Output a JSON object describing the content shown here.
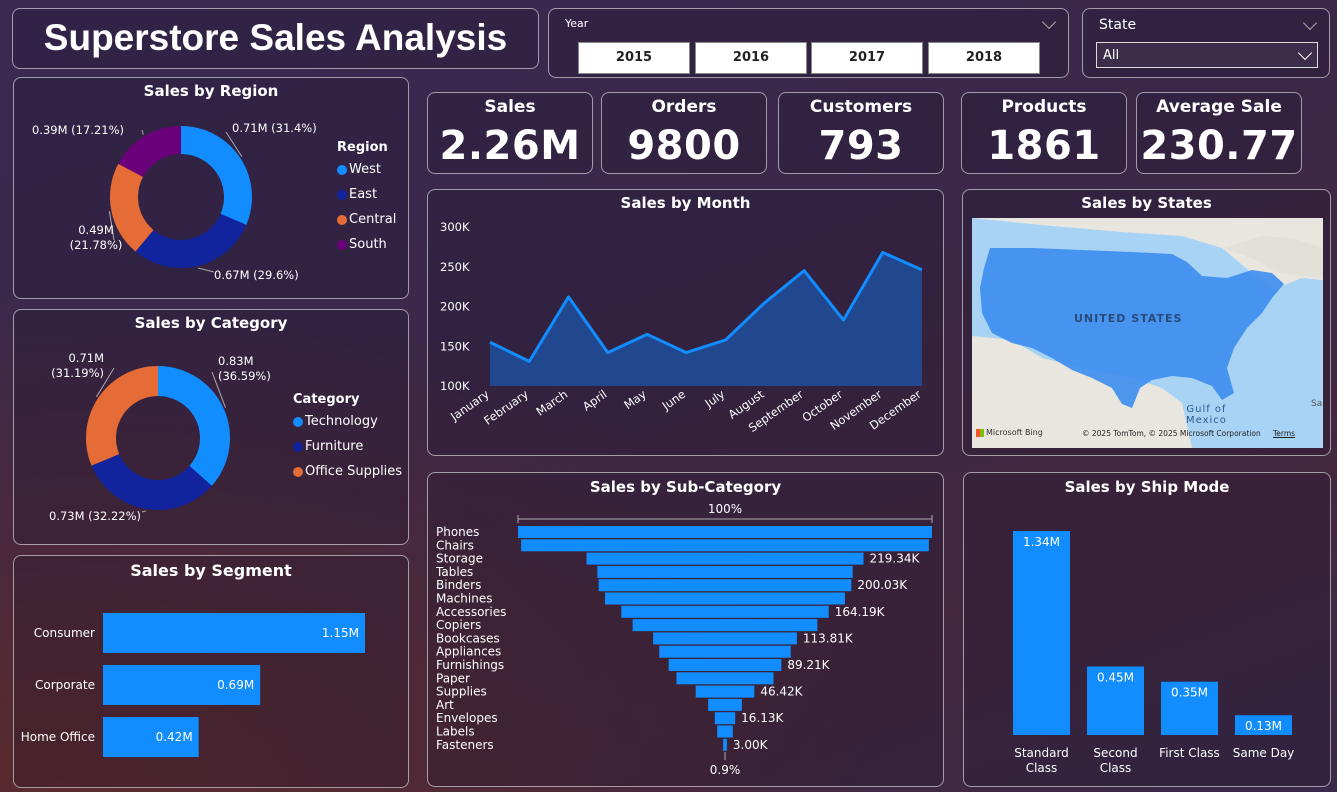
{
  "header": {
    "title": "Superstore Sales Analysis"
  },
  "year_filter": {
    "label": "Year",
    "options": [
      "2015",
      "2016",
      "2017",
      "2018"
    ]
  },
  "state_filter": {
    "label": "State",
    "value": "All"
  },
  "kpis": [
    {
      "label": "Sales",
      "value": "2.26M"
    },
    {
      "label": "Orders",
      "value": "9800"
    },
    {
      "label": "Customers",
      "value": "793"
    },
    {
      "label": "Products",
      "value": "1861"
    },
    {
      "label": "Average Sale",
      "value": "230.77"
    }
  ],
  "map": {
    "title": "Sales by States",
    "country_label": "UNITED STATES",
    "gulf_label_1": "Gulf of",
    "gulf_label_2": "Mexico",
    "edge_label": "Sa",
    "bing_logo": "Microsoft Bing",
    "copyright": "© 2025 TomTom, © 2025 Microsoft Corporation",
    "terms": "Terms"
  },
  "chart_data": [
    {
      "id": "region",
      "type": "pie",
      "title": "Sales by Region",
      "legend_title": "Region",
      "categories": [
        "West",
        "East",
        "Central",
        "South"
      ],
      "values": [
        0.71,
        0.67,
        0.49,
        0.39
      ],
      "labels": [
        "0.71M (31.4%)",
        "0.67M (29.6%)",
        "0.49M (21.78%)",
        "0.39M (17.21%)"
      ],
      "colors": [
        "#118dff",
        "#12239e",
        "#e66c37",
        "#6b007b"
      ]
    },
    {
      "id": "category",
      "type": "pie",
      "title": "Sales by Category",
      "legend_title": "Category",
      "categories": [
        "Technology",
        "Furniture",
        "Office Supplies"
      ],
      "values": [
        0.83,
        0.73,
        0.71
      ],
      "labels": [
        "0.83M (36.59%)",
        "0.73M (32.22%)",
        "0.71M (31.19%)"
      ],
      "colors": [
        "#118dff",
        "#12239e",
        "#e66c37"
      ]
    },
    {
      "id": "segment",
      "type": "bar",
      "orientation": "horizontal",
      "title": "Sales by Segment",
      "categories": [
        "Consumer",
        "Corporate",
        "Home Office"
      ],
      "values": [
        1.15,
        0.69,
        0.42
      ],
      "labels": [
        "1.15M",
        "0.69M",
        "0.42M"
      ],
      "color": "#118dff"
    },
    {
      "id": "month",
      "type": "area",
      "title": "Sales by Month",
      "categories": [
        "January",
        "February",
        "March",
        "April",
        "May",
        "June",
        "July",
        "August",
        "September",
        "October",
        "November",
        "December"
      ],
      "values": [
        155000,
        131000,
        212000,
        142000,
        165000,
        142000,
        158000,
        205000,
        245000,
        183000,
        268000,
        246000
      ],
      "yticks": [
        "100K",
        "150K",
        "200K",
        "250K",
        "300K"
      ],
      "ylim": [
        100000,
        300000
      ],
      "color": "#118dff"
    },
    {
      "id": "subcategory",
      "type": "bar",
      "orientation": "funnel",
      "title": "Sales by Sub-Category",
      "categories": [
        "Phones",
        "Chairs",
        "Storage",
        "Tables",
        "Binders",
        "Machines",
        "Accessories",
        "Copiers",
        "Bookcases",
        "Appliances",
        "Furnishings",
        "Paper",
        "Supplies",
        "Art",
        "Envelopes",
        "Labels",
        "Fasteners"
      ],
      "values": [
        327.78,
        322.82,
        219.34,
        202.08,
        200.03,
        189.93,
        164.19,
        146.25,
        113.81,
        104.06,
        89.21,
        76.83,
        46.42,
        26.71,
        16.13,
        12.35,
        3.0
      ],
      "labels": [
        "",
        "",
        "219.34K",
        "",
        "200.03K",
        "",
        "164.19K",
        "",
        "113.81K",
        "",
        "89.21K",
        "",
        "46.42K",
        "",
        "16.13K",
        "",
        "3.00K"
      ],
      "top_label": "100%",
      "bottom_label": "0.9%",
      "color": "#118dff"
    },
    {
      "id": "shipmode",
      "type": "bar",
      "title": "Sales by Ship Mode",
      "categories": [
        "Standard Class",
        "Second Class",
        "First Class",
        "Same Day"
      ],
      "category_lines": [
        [
          "Standard",
          "Class"
        ],
        [
          "Second",
          "Class"
        ],
        [
          "First Class"
        ],
        [
          "Same Day"
        ]
      ],
      "values": [
        1.34,
        0.45,
        0.35,
        0.13
      ],
      "labels": [
        "1.34M",
        "0.45M",
        "0.35M",
        "0.13M"
      ],
      "color": "#118dff"
    }
  ]
}
